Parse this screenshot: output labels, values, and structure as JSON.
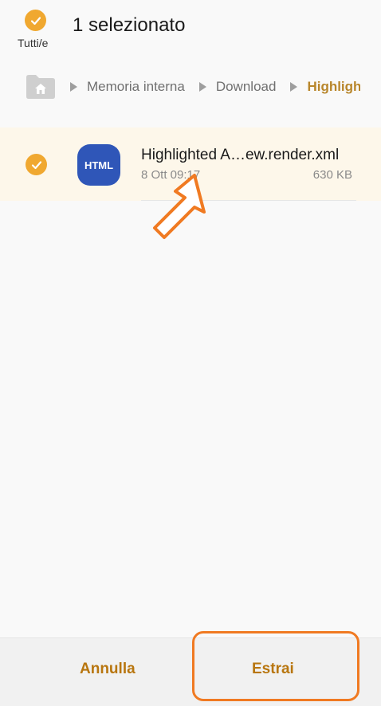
{
  "header": {
    "select_all_label": "Tutti/e",
    "title": "1 selezionato"
  },
  "breadcrumb": {
    "home_icon": "home-folder-icon",
    "items": [
      {
        "label": "Memoria interna"
      },
      {
        "label": "Download"
      },
      {
        "label": "Highlight"
      }
    ]
  },
  "file_list": {
    "items": [
      {
        "selected": true,
        "icon_text": "HTML",
        "name": "Highlighted A…ew.render.xml",
        "date": "8 Ott 09:17",
        "size": "630 KB"
      }
    ]
  },
  "bottom_bar": {
    "cancel_label": "Annulla",
    "extract_label": "Estrai"
  },
  "colors": {
    "accent": "#f0a830",
    "action_text": "#b8760f",
    "annotation": "#f07a22",
    "file_icon_bg": "#2f56b8",
    "row_selected_bg": "#fdf7ea"
  }
}
